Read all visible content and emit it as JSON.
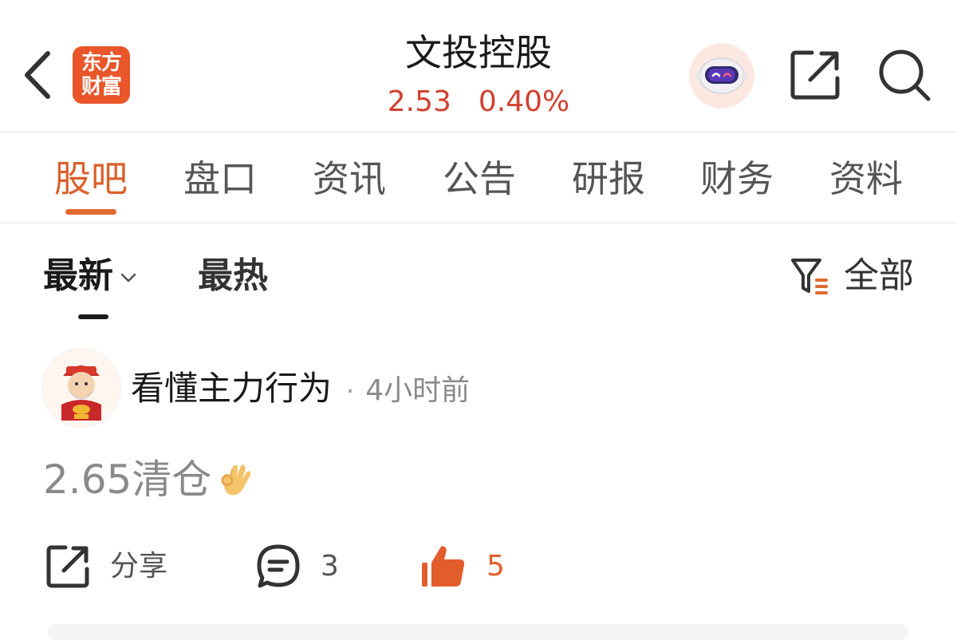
{
  "header": {
    "back_icon": "chevron-left-icon",
    "logo_line1": "东方",
    "logo_line2": "财富",
    "brand_color": "#e8562a",
    "stock_name": "文投控股",
    "price": "2.53",
    "change_pct": "0.40%",
    "quote_color": "#d0402f",
    "robot_icon": "robot-assistant-icon",
    "share_icon": "share-icon",
    "search_icon": "search-icon"
  },
  "tabs": [
    {
      "label": "股吧",
      "active": true
    },
    {
      "label": "盘口",
      "active": false
    },
    {
      "label": "资讯",
      "active": false
    },
    {
      "label": "公告",
      "active": false
    },
    {
      "label": "研报",
      "active": false
    },
    {
      "label": "财务",
      "active": false
    },
    {
      "label": "资料",
      "active": false
    }
  ],
  "accent_color": "#e0692f",
  "sort": {
    "latest_label": "最新",
    "hot_label": "最热",
    "filter_icon": "filter-icon",
    "filter_label": "全部"
  },
  "post": {
    "avatar_icon": "god-of-wealth-avatar",
    "username": "看懂主力行为",
    "separator": "·",
    "time": "4小时前",
    "content": "2.65清仓",
    "content_emoji": "👌",
    "share_label": "分享",
    "comment_count": "3",
    "like_count": "5"
  }
}
